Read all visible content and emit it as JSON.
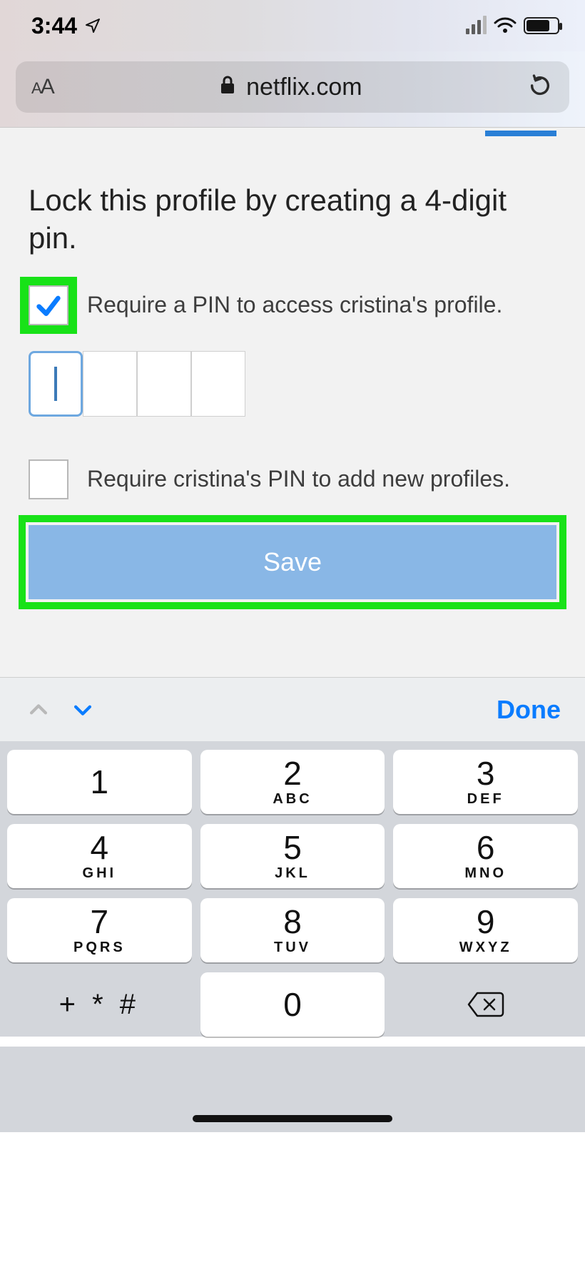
{
  "status": {
    "time": "3:44",
    "location_icon": "location-arrow"
  },
  "browser": {
    "reader_button": "AA",
    "domain": "netflix.com",
    "secure": true
  },
  "content": {
    "title": "Lock this profile by creating a 4-digit pin.",
    "option_access": {
      "checked": true,
      "label": "Require a PIN to access cristina's profile."
    },
    "pin_digits": [
      "",
      "",
      "",
      ""
    ],
    "option_add_profiles": {
      "checked": false,
      "label": "Require cristina's PIN to add new profiles."
    },
    "save_label": "Save"
  },
  "keyboard": {
    "done_label": "Done",
    "keys": [
      [
        {
          "n": "1",
          "s": ""
        },
        {
          "n": "2",
          "s": "ABC"
        },
        {
          "n": "3",
          "s": "DEF"
        }
      ],
      [
        {
          "n": "4",
          "s": "GHI"
        },
        {
          "n": "5",
          "s": "JKL"
        },
        {
          "n": "6",
          "s": "MNO"
        }
      ],
      [
        {
          "n": "7",
          "s": "PQRS"
        },
        {
          "n": "8",
          "s": "TUV"
        },
        {
          "n": "9",
          "s": "WXYZ"
        }
      ]
    ],
    "symbols_key": "+ * #",
    "zero_key": "0"
  }
}
